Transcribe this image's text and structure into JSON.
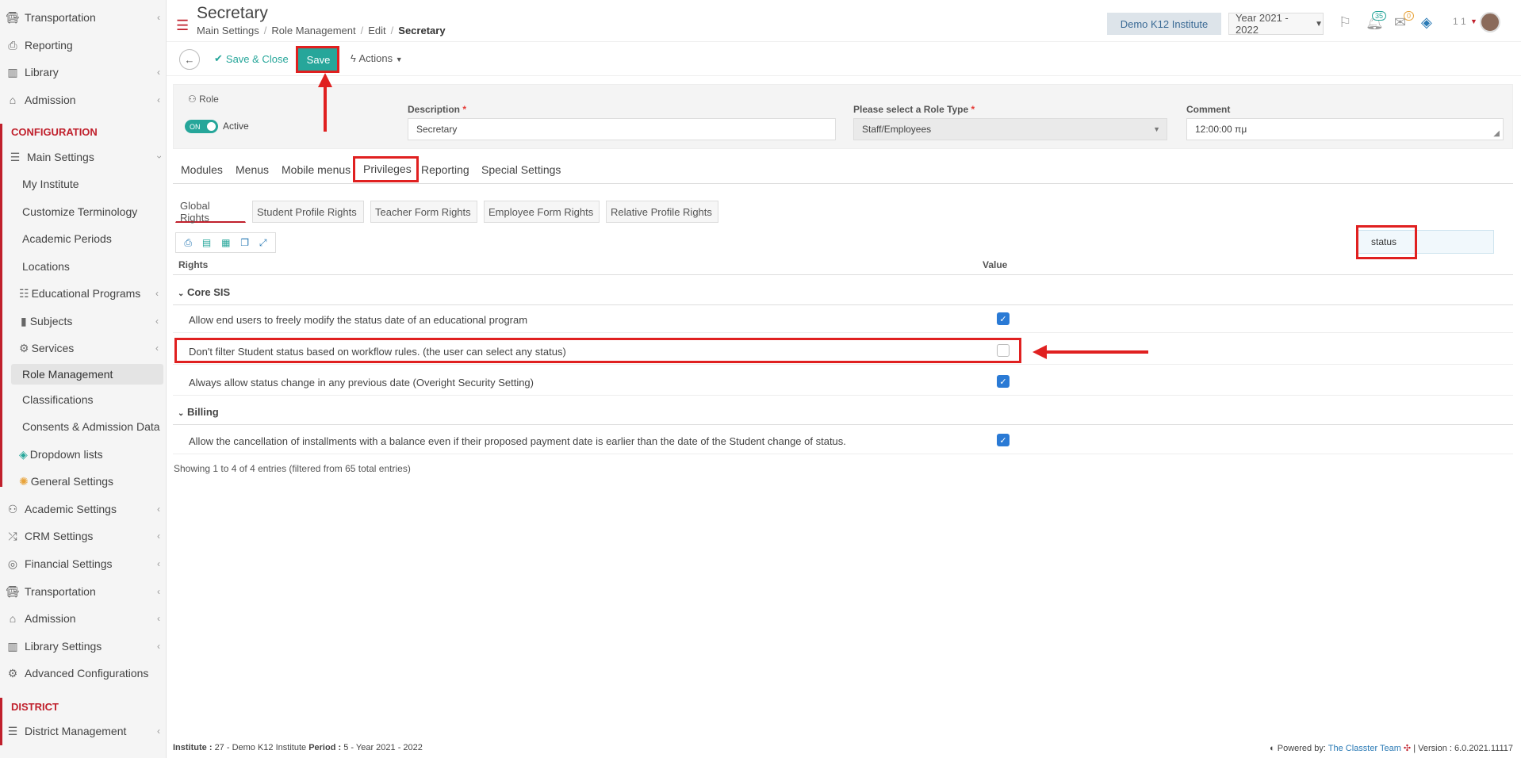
{
  "sidebar": {
    "items_top": [
      {
        "label": "Transportation",
        "icon": "bus-icon",
        "chevron": "‹"
      },
      {
        "label": "Reporting",
        "icon": "printer-icon",
        "chevron": ""
      },
      {
        "label": "Library",
        "icon": "books-icon",
        "chevron": "‹"
      },
      {
        "label": "Admission",
        "icon": "bank-icon",
        "chevron": "‹"
      }
    ],
    "config_header": "CONFIGURATION",
    "main_settings": {
      "label": "Main Settings",
      "chevron": "‹"
    },
    "sub_items": [
      {
        "label": "My Institute"
      },
      {
        "label": "Customize Terminology"
      },
      {
        "label": "Academic Periods"
      },
      {
        "label": "Locations"
      },
      {
        "label": "Educational Programs",
        "chevron": "‹"
      },
      {
        "label": "Subjects",
        "chevron": "‹"
      },
      {
        "label": "Services",
        "chevron": "‹"
      },
      {
        "label": "Role Management"
      },
      {
        "label": "Classifications"
      },
      {
        "label": "Consents & Admission Data"
      },
      {
        "label": "Dropdown lists"
      },
      {
        "label": "General Settings"
      }
    ],
    "items_bottom": [
      {
        "label": "Academic Settings",
        "chevron": "‹"
      },
      {
        "label": "CRM Settings",
        "chevron": "‹"
      },
      {
        "label": "Financial Settings",
        "chevron": "‹"
      },
      {
        "label": "Transportation",
        "chevron": "‹"
      },
      {
        "label": "Admission",
        "chevron": "‹"
      },
      {
        "label": "Library Settings",
        "chevron": "‹"
      },
      {
        "label": "Advanced Configurations",
        "chevron": ""
      }
    ],
    "district_header": "DISTRICT",
    "district_item": {
      "label": "District Management",
      "chevron": "‹"
    }
  },
  "header": {
    "title": "Secretary",
    "breadcrumb": [
      "Main Settings",
      "Role Management",
      "Edit",
      "Secretary"
    ],
    "institute": "Demo K12 Institute",
    "year": "Year 2021 - 2022",
    "notif_count": "35",
    "mail_count": "0",
    "user_short": "1 1"
  },
  "toolbar": {
    "save_close": "Save & Close",
    "save": "Save",
    "actions": "Actions"
  },
  "form": {
    "role_label": "Role",
    "toggle": "ON",
    "active_label": "Active",
    "description_label": "Description",
    "description_value": "Secretary",
    "role_type_label": "Please select a Role Type",
    "role_type_value": "Staff/Employees",
    "comment_label": "Comment",
    "comment_value": "12:00:00 πμ",
    "required_mark": "*"
  },
  "tabs": [
    "Modules",
    "Menus",
    "Mobile menus",
    "Privileges",
    "Reporting",
    "Special Settings"
  ],
  "subtabs": [
    "Global Rights",
    "Student Profile Rights",
    "Teacher Form Rights",
    "Employee Form Rights",
    "Relative Profile Rights"
  ],
  "search": {
    "value": "status"
  },
  "table": {
    "headers": [
      "Rights",
      "Value"
    ],
    "groups": [
      {
        "name": "Core SIS",
        "rows": [
          {
            "text": "Allow end users to freely modify the status date of an educational program",
            "checked": true
          },
          {
            "text": "Don't filter Student status based on workflow rules. (the user can select any status)",
            "checked": false
          },
          {
            "text": "Always allow status change in any previous date (Overight Security Setting)",
            "checked": true
          }
        ]
      },
      {
        "name": "Billing",
        "rows": [
          {
            "text": "Allow the cancellation of installments with a balance even if their proposed payment date is earlier than the date of the Student change of status.",
            "checked": true
          }
        ]
      }
    ],
    "showing": "Showing 1 to 4 of 4 entries (filtered from 65 total entries)"
  },
  "footer": {
    "institute_label": "Institute :",
    "institute_value": "27 - Demo K12 Institute",
    "period_label": "Period :",
    "period_value": "5 - Year 2021 - 2022",
    "powered": "Powered by:",
    "team": "The Classter Team",
    "version": "| Version : 6.0.2021.11117"
  },
  "colors": {
    "accent": "#26a69a",
    "brand_red": "#c0202c",
    "checkbox": "#2a7ad5",
    "annotation": "#e02020"
  }
}
